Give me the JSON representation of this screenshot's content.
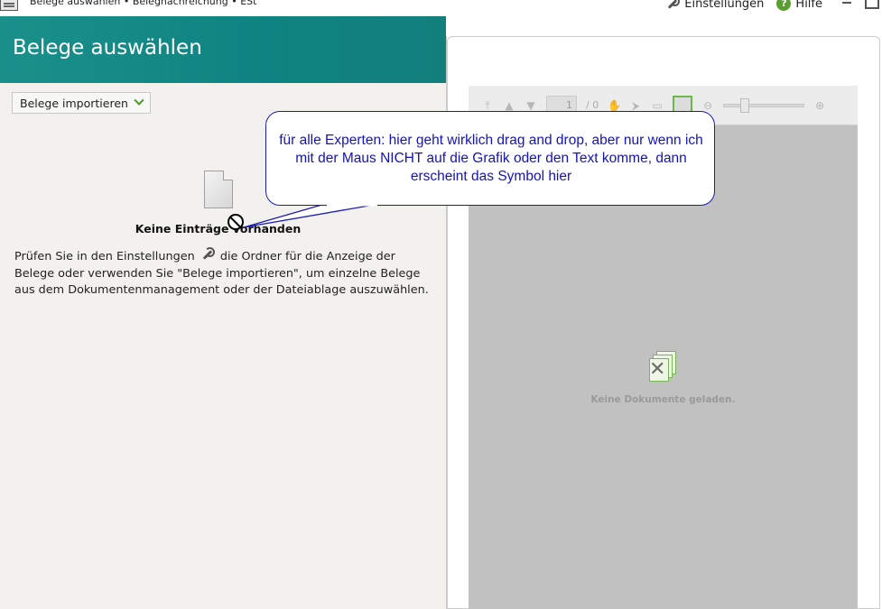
{
  "window": {
    "title": "Belege auswählen • Belegnachreichung • ESt",
    "settings_label": "Einstellungen",
    "help_label": "Hilfe"
  },
  "header": {
    "title": "Belege auswählen"
  },
  "left": {
    "import_button": "Belege importieren",
    "empty_title": "Keine Einträge vorhanden",
    "hint_part1": "Prüfen Sie in den Einstellungen",
    "hint_part2": "die Ordner für die Anzeige der Belege oder verwenden Sie \"Belege importieren\", um einzelne Belege aus dem Dokumentenmanagement oder der Dateiablage auszuwählen."
  },
  "viewer": {
    "page_value": "1",
    "page_total": "/ 0",
    "empty_text": "Keine Dokumente geladen."
  },
  "callout": {
    "text": "für alle Experten: hier geht wirklich drag and drop, aber nur wenn ich mit der Maus NICHT auf die Grafik oder den Text komme, dann erscheint das Symbol hier"
  },
  "colors": {
    "header": "#0f8381",
    "accent_green": "#5a9e2f",
    "callout_blue": "#1414b8"
  }
}
